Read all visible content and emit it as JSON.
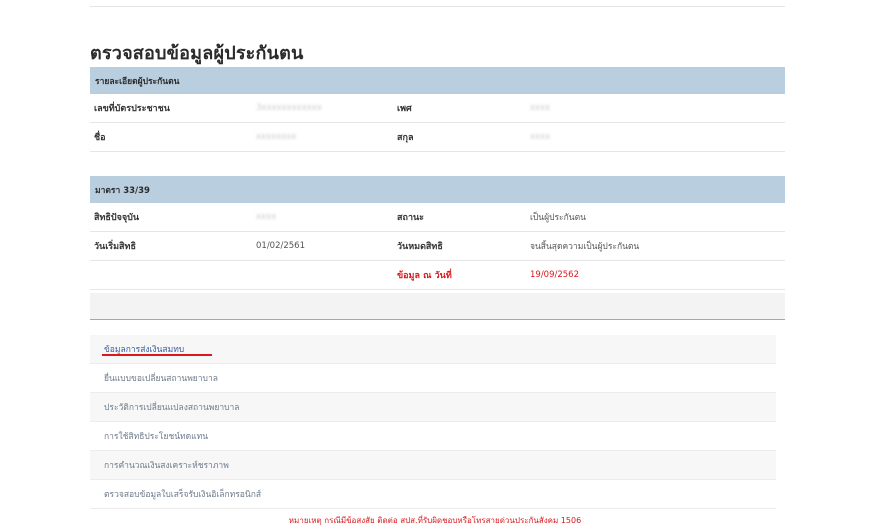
{
  "page_title": "ตรวจสอบข้อมูลผู้ประกันตน",
  "insured_details": {
    "header": "รายละเอียดผู้ประกันตน",
    "rows": [
      {
        "label1": "เลขที่บัตรประชาชน",
        "value1": "3xxxxxxxxxxxx",
        "label2": "เพศ",
        "value2": "xxxx"
      },
      {
        "label1": "ชื่อ",
        "value1": "xxxxxxxx",
        "label2": "สกุล",
        "value2": "xxxx"
      }
    ]
  },
  "section_33_39": {
    "header": "มาตรา 33/39",
    "rows": [
      {
        "label1": "สิทธิปัจจุบัน",
        "value1": "xxxx",
        "label2": "สถานะ",
        "value2": "เป็นผู้ประกันตน"
      },
      {
        "label1": "วันเริ่มสิทธิ",
        "value1": "01/02/2561",
        "label2": "วันหมดสิทธิ",
        "value2": "จนสิ้นสุดความเป็นผู้ประกันตน"
      },
      {
        "label1": "",
        "value1": "",
        "label2": "ข้อมูล ณ วันที่",
        "value2": "19/09/2562"
      }
    ]
  },
  "links": [
    "ข้อมูลการส่งเงินสมทบ",
    "ยื่นแบบขอเปลี่ยนสถานพยาบาล",
    "ประวัติการเปลี่ยนแปลงสถานพยาบาล",
    "การใช้สิทธิประโยชน์ทดแทน",
    "การคำนวณเงินสงเคราะห์ชราภาพ",
    "ตรวจสอบข้อมูลใบเสร็จรับเงินอิเล็กทรอนิกส์"
  ],
  "note": "หมายเหตุ กรณีมีข้อสงสัย ติดต่อ สปส.ที่รับผิดชอบหรือโทรสายด่วนประกันสังคม 1506",
  "colors": {
    "header_bg": "#b9cfe0",
    "accent_red": "#d9191e",
    "gold_divider": "#d9a62e"
  }
}
